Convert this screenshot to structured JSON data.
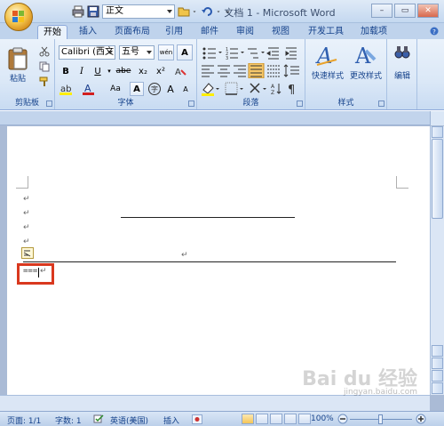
{
  "window": {
    "title": "文档 1 - Microsoft Word"
  },
  "qat": {
    "style_value": "正文"
  },
  "tabs": [
    {
      "label": "开始",
      "active": true
    },
    {
      "label": "插入"
    },
    {
      "label": "页面布局"
    },
    {
      "label": "引用"
    },
    {
      "label": "邮件"
    },
    {
      "label": "审阅"
    },
    {
      "label": "视图"
    },
    {
      "label": "开发工具"
    },
    {
      "label": "加载项"
    }
  ],
  "ribbon": {
    "clipboard": {
      "label": "剪贴板",
      "paste_label": "粘贴"
    },
    "font": {
      "label": "字体",
      "font_name": "Calibri (西文)",
      "font_size": "五号",
      "bold": "B",
      "italic": "I",
      "underline": "U",
      "strike": "abe",
      "subscript": "x₂",
      "superscript": "x²",
      "font_color_a": "A",
      "case": "Aa",
      "char_border": "A",
      "grow": "A",
      "shrink": "A"
    },
    "paragraph": {
      "label": "段落"
    },
    "styles": {
      "label": "样式",
      "quick_styles": "快速样式",
      "change_styles": "更改样式"
    },
    "editing": {
      "label": "编辑"
    }
  },
  "document": {
    "equals_text": "===",
    "paragraph_mark": "↵"
  },
  "status": {
    "page": "页面: 1/1",
    "words": "字数: 1",
    "language": "英语(美国)",
    "insert_mode": "插入",
    "zoom": "100%"
  },
  "watermark": {
    "brand": "Bai du 经验",
    "url": "jingyan.baidu.com"
  },
  "colors": {
    "accent": "#15428b",
    "highlight_box": "#d9381e",
    "ribbon_bg": "#dbe8f7"
  }
}
